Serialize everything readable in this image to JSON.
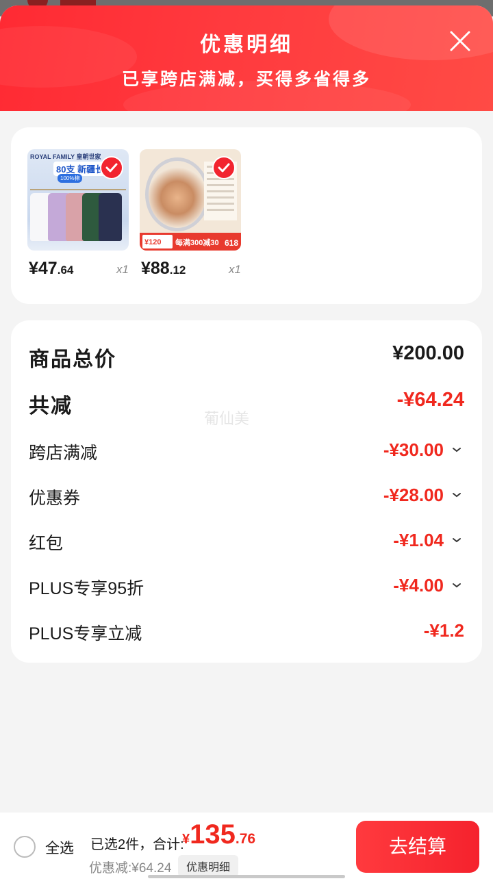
{
  "header": {
    "title": "优惠明细",
    "subtitle": "已享跨店满减，买得多省得多"
  },
  "products": [
    {
      "price_int": "¥47",
      "price_dec": ".64",
      "qty": "x1",
      "image_text": {
        "brand": "ROYAL FAMILY 皇朝世家",
        "tag": "80支 新疆长绒",
        "tag2": "100%棉"
      }
    },
    {
      "price_int": "¥88",
      "price_dec": ".12",
      "qty": "x1",
      "image_text": {
        "box": "¥120",
        "promo": "每满300减30",
        "badge": "618"
      }
    }
  ],
  "summary": {
    "watermark": "葡仙美",
    "rows": [
      {
        "label": "商品总价",
        "value": "¥200.00"
      },
      {
        "label": "共减",
        "value": "-¥64.24"
      },
      {
        "label": "跨店满减",
        "value": "-¥30.00"
      },
      {
        "label": "优惠券",
        "value": "-¥28.00"
      },
      {
        "label": "红包",
        "value": "-¥1.04"
      },
      {
        "label": "PLUS专享95折",
        "value": "-¥4.00"
      },
      {
        "label": "PLUS专享立减",
        "value": "-¥1.2"
      }
    ]
  },
  "bottom_bar": {
    "select_all": "全选",
    "selected_text": "已选2件，合计:",
    "total_cur": "¥",
    "total_int": "135",
    "total_dec": ".76",
    "discount_text": "优惠减:¥64.24",
    "detail_button": "优惠明细",
    "checkout_button": "去结算"
  },
  "colors": {
    "accent": "#f0281e",
    "header": "#ff2a33"
  }
}
